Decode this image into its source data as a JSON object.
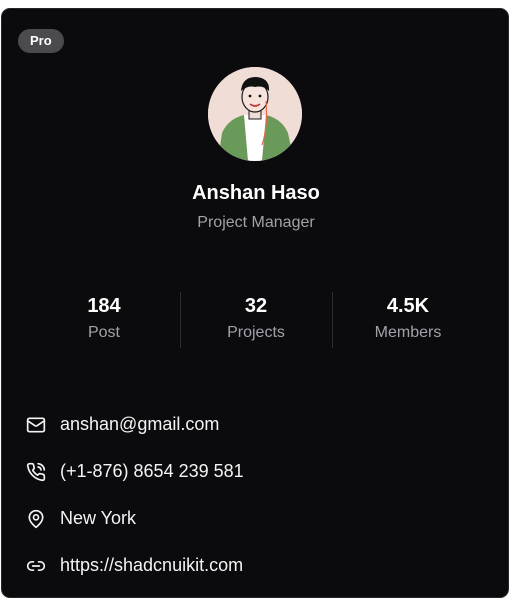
{
  "profile": {
    "badge": "Pro",
    "name": "Anshan Haso",
    "role": "Project Manager"
  },
  "stats": [
    {
      "value": "184",
      "label": "Post"
    },
    {
      "value": "32",
      "label": "Projects"
    },
    {
      "value": "4.5K",
      "label": "Members"
    }
  ],
  "contacts": [
    {
      "icon": "mail-icon",
      "text": "anshan@gmail.com"
    },
    {
      "icon": "phone-icon",
      "text": "(+1-876) 8654 239 581"
    },
    {
      "icon": "map-pin-icon",
      "text": "New York"
    },
    {
      "icon": "link-icon",
      "text": "https://shadcnuikit.com"
    }
  ],
  "colors": {
    "card_bg": "#0b0b0d",
    "badge_bg": "#4a4a4f",
    "muted_text": "#a1a1aa",
    "avatar_bg": "#f0ddd6",
    "avatar_jacket": "#6a9a5a"
  }
}
